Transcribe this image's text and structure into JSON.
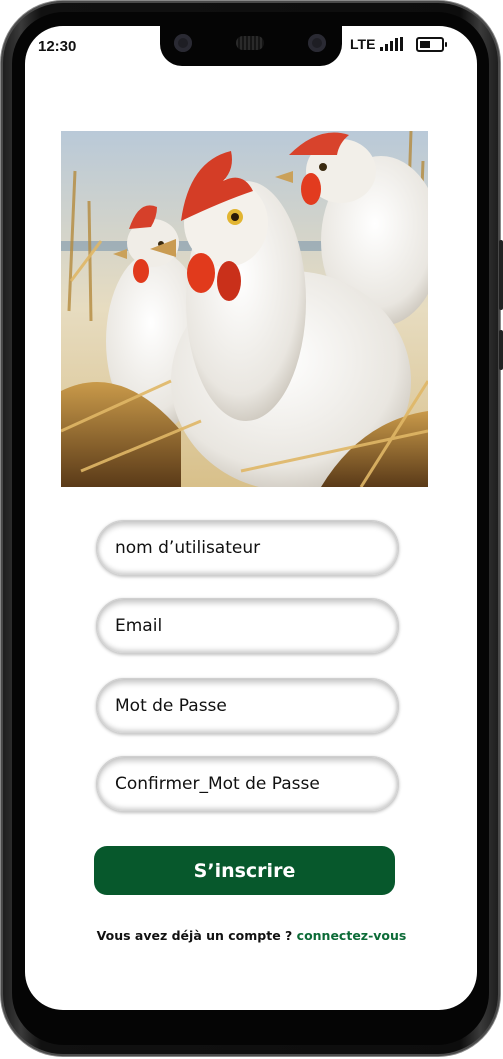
{
  "status_bar": {
    "time": "12:30",
    "network": "LTE"
  },
  "hero": {
    "description_icon": "hens-in-straw-illustration"
  },
  "form": {
    "username_placeholder": "nom d’utilisateur",
    "email_placeholder": "Email",
    "password_placeholder": "Mot de Passe",
    "confirm_password_placeholder": "Confirmer_Mot de Passe",
    "submit_label": "S’inscrire"
  },
  "footer": {
    "prompt": "Vous avez déjà un compte ?",
    "login_link": "connectez-vous"
  },
  "colors": {
    "primary": "#07582c",
    "link": "#0c6b37"
  }
}
